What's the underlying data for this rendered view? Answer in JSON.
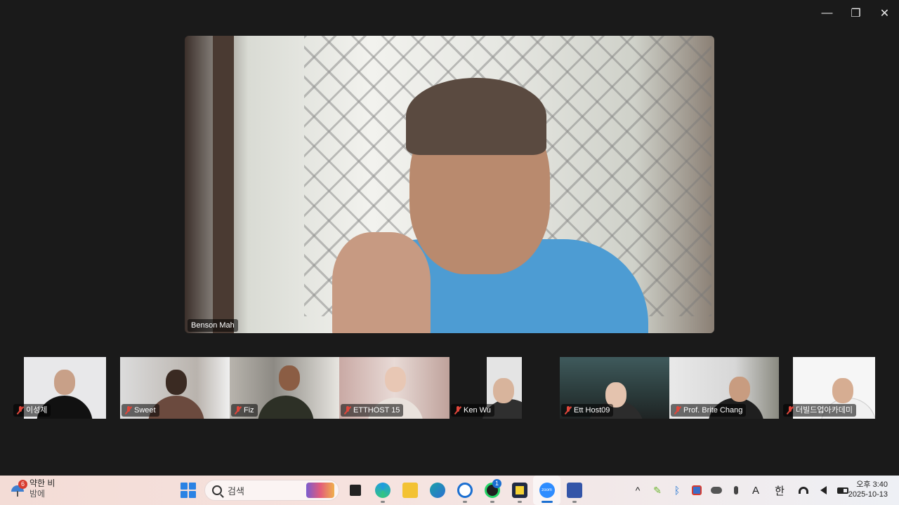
{
  "window_controls": {
    "minimize": "—",
    "restore": "❐",
    "close": "✕"
  },
  "main_speaker": {
    "name": "Benson Mah"
  },
  "participants": [
    {
      "name": "이성제",
      "muted": true
    },
    {
      "name": "Sweet",
      "muted": true
    },
    {
      "name": "Fiz",
      "muted": true
    },
    {
      "name": "ETTHOST 15",
      "muted": true
    },
    {
      "name": "Ken Wu",
      "muted": true
    },
    {
      "name": "Ett Host09",
      "muted": true
    },
    {
      "name": "Prof. Brite Chang",
      "muted": true
    },
    {
      "name": "더빌드업아카데미",
      "muted": true
    }
  ],
  "taskbar": {
    "weather": {
      "badge": "6",
      "condition": "약한 비",
      "sub": "밤에"
    },
    "search_placeholder": "검색",
    "apps": [
      {
        "icon": "task-view-icon"
      },
      {
        "icon": "edge-icon"
      },
      {
        "icon": "file-explorer-icon"
      },
      {
        "icon": "copilot-icon"
      },
      {
        "icon": "screenshot-tool-icon"
      },
      {
        "icon": "whatsapp-icon",
        "badge": "1"
      },
      {
        "icon": "sticky-notes-icon"
      },
      {
        "icon": "zoom-icon",
        "label": "zoom",
        "active": true
      },
      {
        "icon": "whiteboard-icon"
      }
    ],
    "tray": {
      "chevron": "^",
      "pen": "✎",
      "bluetooth": "ᛒ",
      "ime_a": "A",
      "ime_han": "한"
    },
    "clock": {
      "time": "오후 3:40",
      "date": "2025-10-13"
    }
  }
}
